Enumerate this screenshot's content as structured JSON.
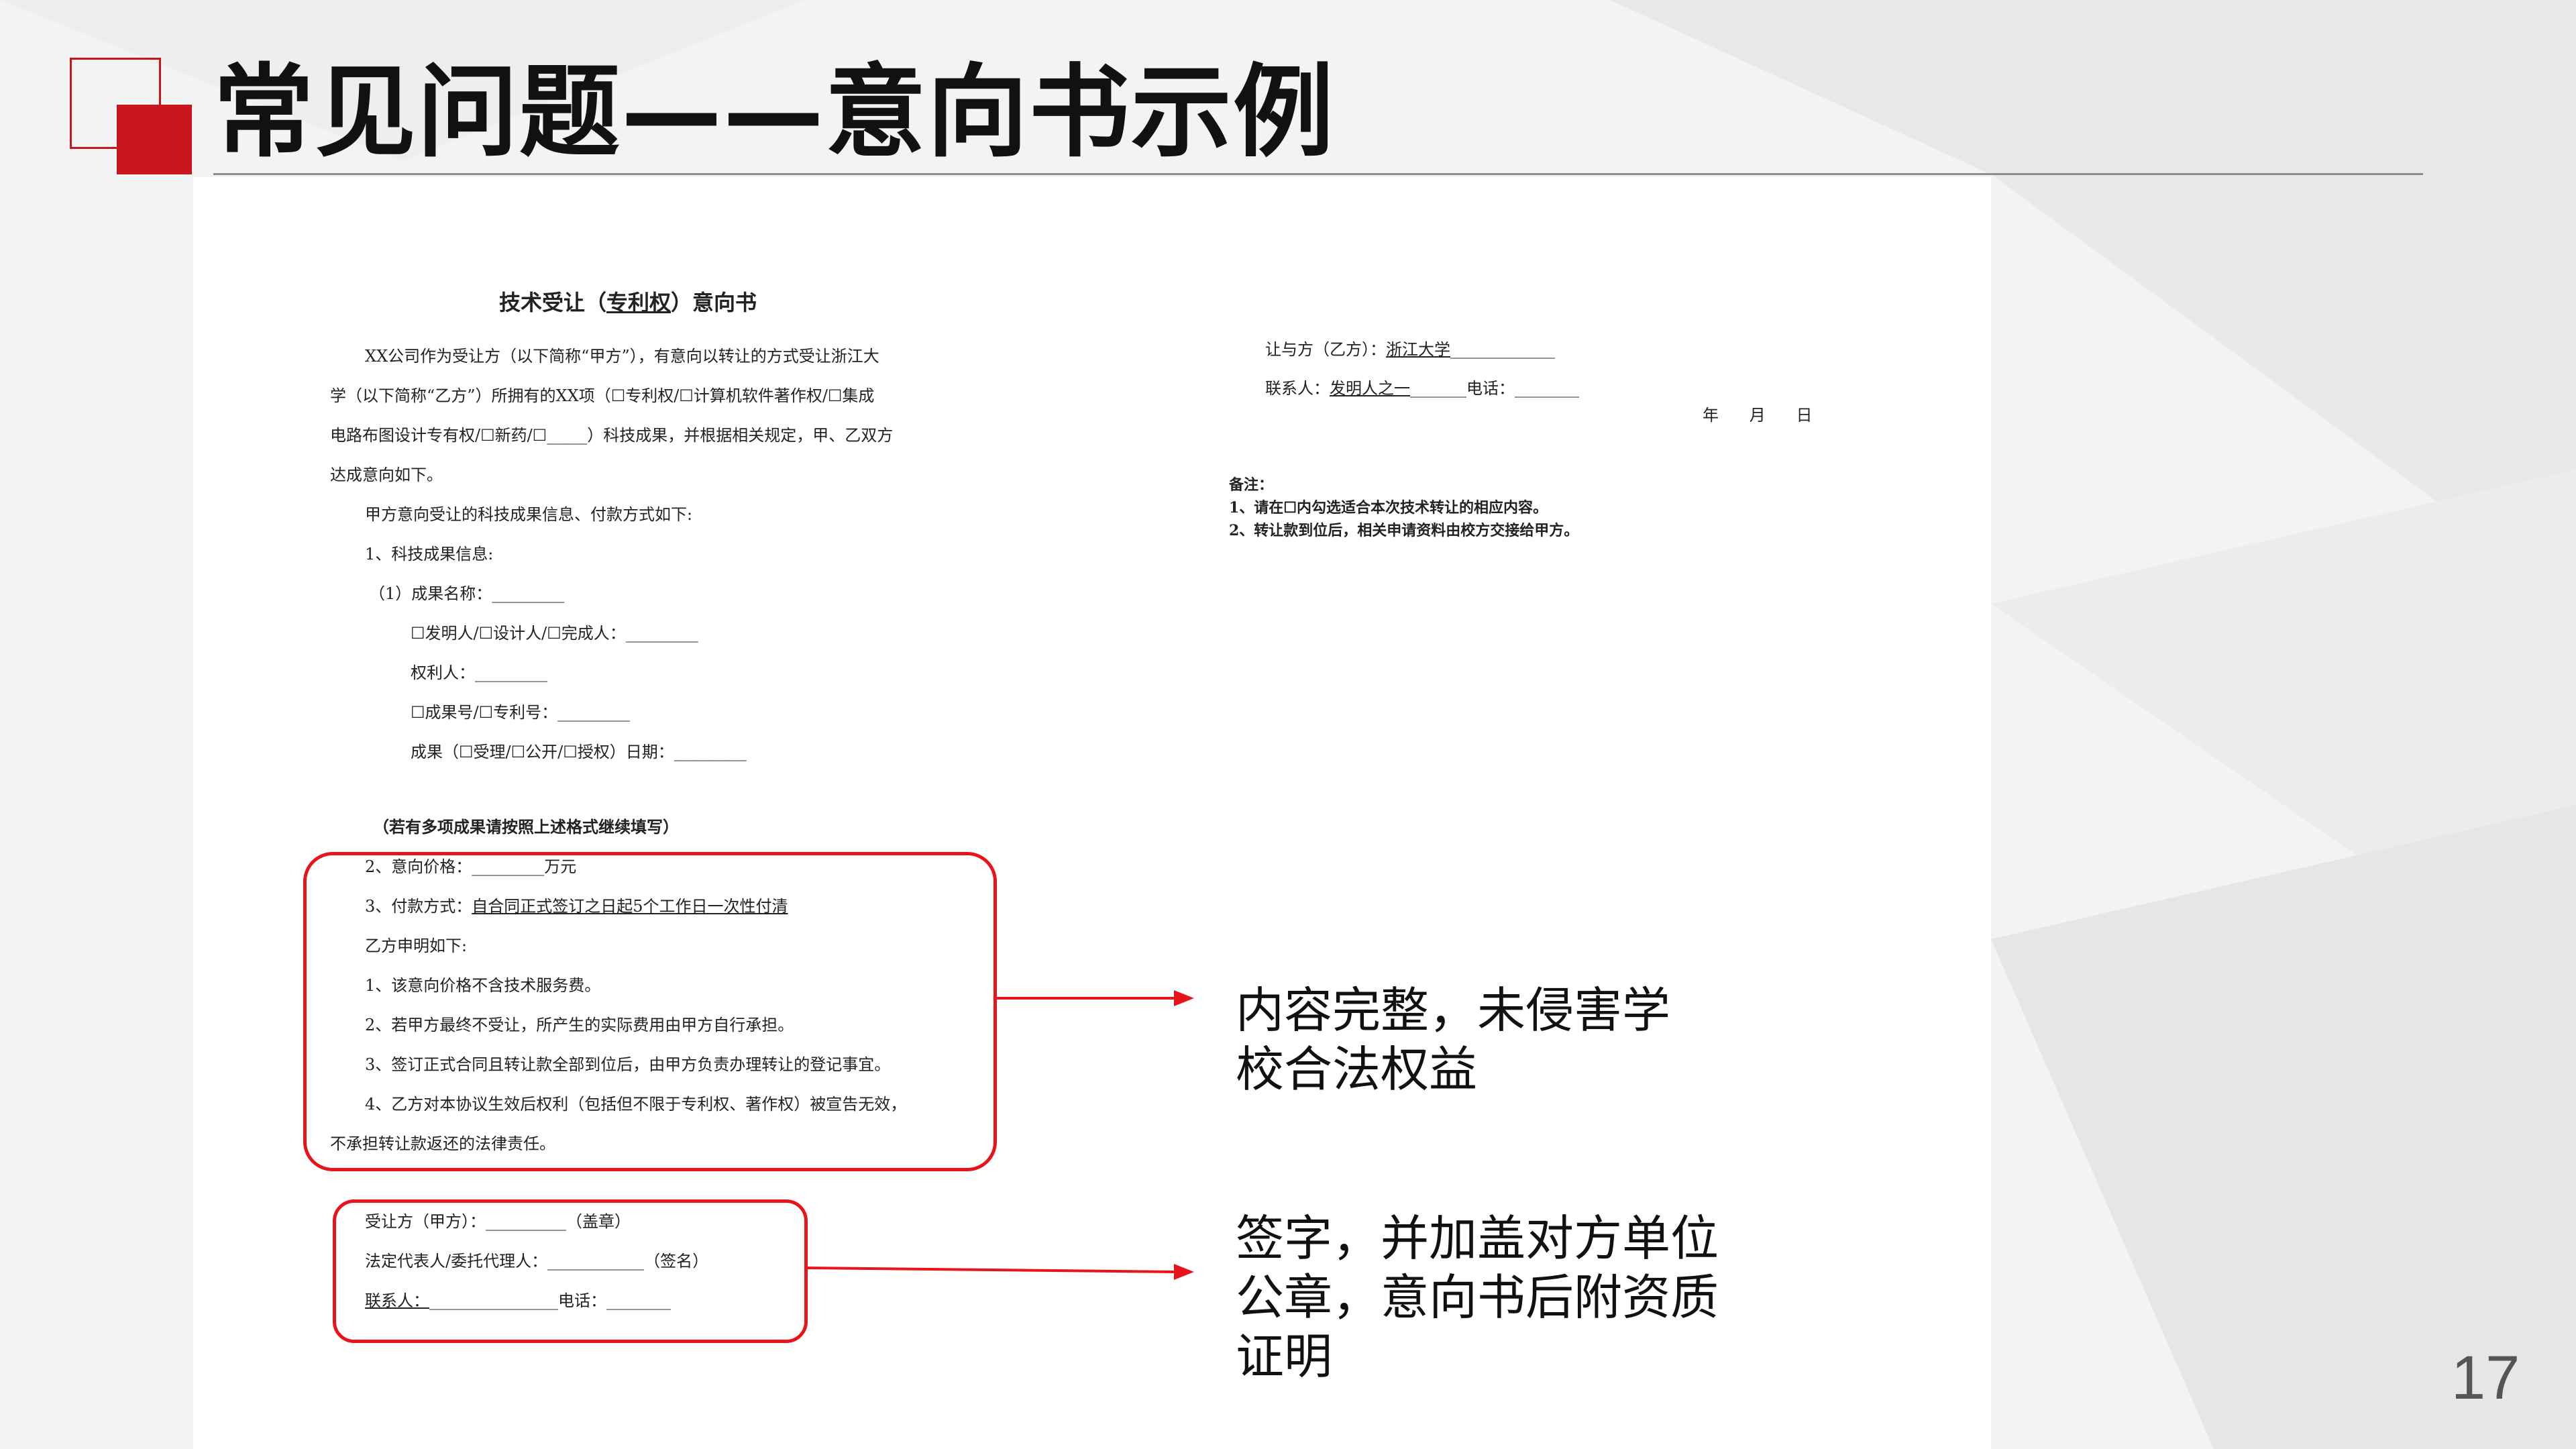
{
  "slide": {
    "title": "常见问题——意向书示例",
    "page_number": "17",
    "accent_color": "#c9161c",
    "highlight_color": "#e8141b"
  },
  "document": {
    "title_prefix": "技术受让（",
    "title_underlined": "专利权",
    "title_suffix": "）意向书",
    "para1_line1": "XX公司作为受让方（以下简称“甲方”），有意向以转让的方式受让浙江大",
    "para1_line2": "学（以下简称“乙方”）所拥有的XX项（☐专利权/☐计算机软件著作权/☐集成",
    "para1_line3": "电路布图设计专有权/☐新药/☐_____）科技成果，并根据相关规定，甲、乙双方",
    "para1_line4": "达成意向如下。",
    "para2": "甲方意向受让的科技成果信息、付款方式如下:",
    "item1": "1、科技成果信息:",
    "item1_1": "（1）成果名称：_________",
    "inventors": "☐发明人/☐设计人/☐完成人：_________",
    "owner": "权利人：_________",
    "numbers": "☐成果号/☐专利号：_________",
    "dates": "成果（☐受理/☐公开/☐授权）日期：_________",
    "multi_note": "（若有多项成果请按照上述格式继续填写）",
    "price": "2、意向价格：_________万元",
    "payment_label": "3、付款方式：",
    "payment_value": "自合同正式签订之日起5个工作日一次性付清",
    "party_b_statement": "乙方申明如下:",
    "statement_1": "1、该意向价格不含技术服务费。",
    "statement_2": "2、若甲方最终不受让，所产生的实际费用由甲方自行承担。",
    "statement_3": "3、签订正式合同且转让款全部到位后，由甲方负责办理转让的登记事宜。",
    "statement_4_line1": "4、乙方对本协议生效后权利（包括但不限于专利权、著作权）被宣告无效，",
    "statement_4_line2": "不承担转让款返还的法律责任。",
    "sign_a_label": "受让方（甲方）：",
    "sign_a_value": "__________（盖章）",
    "sign_rep_label": "法定代表人/委托代理人：",
    "sign_rep_value": "____________（签名）",
    "sign_contact_label": "联系人：",
    "sign_contact_value": "________________电话：________",
    "transferor_label": "让与方（乙方）：",
    "transferor_value": "浙江大学",
    "contact_b_label": "联系人：",
    "contact_b_value": "发明人之一",
    "phone_b": "电话：________",
    "date_line": "年      月      日",
    "remarks_title": "备注：",
    "remark_1": "1、请在☐内勾选适合本次技术转让的相应内容。",
    "remark_2": "2、转让款到位后，相关申请资料由校方交接给甲方。"
  },
  "callouts": {
    "content": [
      "内容完整，未侵害学",
      "校合法权益"
    ],
    "signature": [
      "签字，并加盖对方单位",
      "公章，意向书后附资质",
      "证明"
    ]
  }
}
